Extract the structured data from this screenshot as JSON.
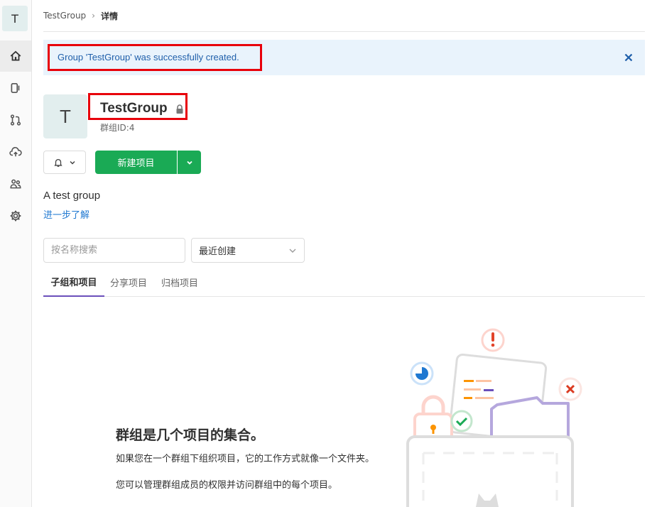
{
  "sidebar": {
    "avatar_letter": "T",
    "items": [
      {
        "icon": "home-icon",
        "active": true
      },
      {
        "icon": "issues-icon"
      },
      {
        "icon": "merge-request-icon"
      },
      {
        "icon": "cloud-upload-icon"
      },
      {
        "icon": "members-icon"
      },
      {
        "icon": "settings-gear-icon"
      }
    ]
  },
  "breadcrumb": {
    "group": "TestGroup",
    "current": "详情"
  },
  "alert": {
    "message": "Group 'TestGroup' was successfully created.",
    "close_icon": "close-icon"
  },
  "group": {
    "avatar_letter": "T",
    "name": "TestGroup",
    "id_label": "群组ID:4",
    "description": "A test group",
    "learn_more": "进一步了解"
  },
  "actions": {
    "new_project_label": "新建项目"
  },
  "filter": {
    "search_placeholder": "按名称搜索",
    "sort_selected": "最近创建"
  },
  "tabs": [
    {
      "label": "子组和项目",
      "active": true
    },
    {
      "label": "分享项目"
    },
    {
      "label": "归档项目"
    }
  ],
  "empty_state": {
    "title": "群组是几个项目的集合。",
    "line1": "如果您在一个群组下组织项目，它的工作方式就像一个文件夹。",
    "line2": "您可以管理群组成员的权限并访问群组中的每个项目。"
  },
  "colors": {
    "primary_green": "#1aaa55",
    "link_blue": "#1f78d1",
    "alert_bg": "#e9f3fc",
    "tab_underline": "#6b4fbb",
    "highlight_red": "#e8000b"
  }
}
